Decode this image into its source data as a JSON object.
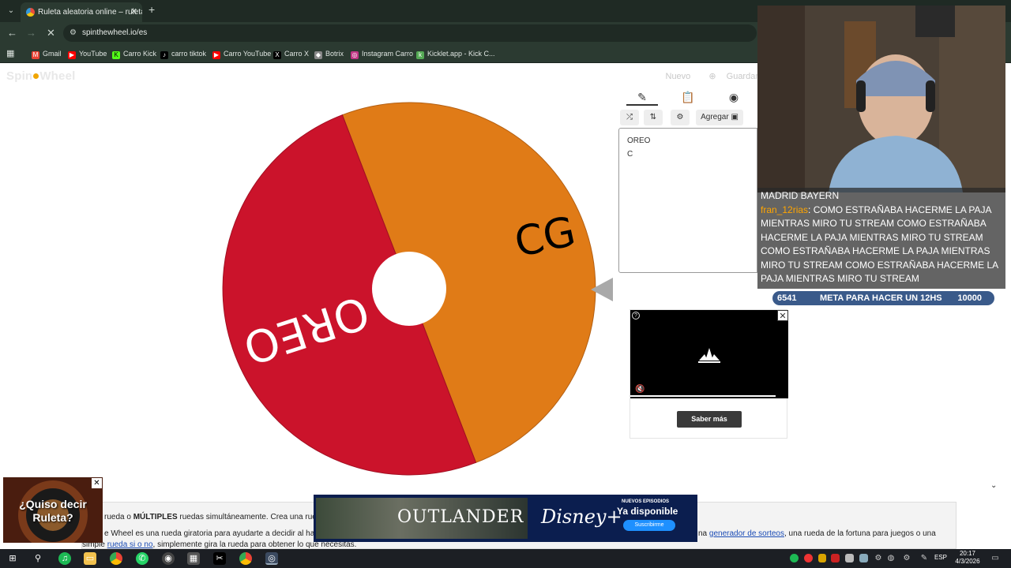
{
  "browser": {
    "tab_title": "Ruleta aleatoria online – ruleta",
    "url": "spinthewheel.io/es",
    "bookmarks": [
      "Gmail",
      "YouTube",
      "Carro Kick",
      "carro tiktok",
      "Carro YouTube",
      "Carro X",
      "Botrix",
      "Instagram Carro",
      "Kicklet.app - Kick C..."
    ]
  },
  "site": {
    "logo_left": "Spin",
    "logo_right": "Wheel",
    "nav_new": "Nuevo",
    "nav_save": "Guardar"
  },
  "wheel": {
    "segments": [
      {
        "label": "CG",
        "color": "#e07b17"
      },
      {
        "label": "OREO",
        "color": "#cb132b"
      }
    ]
  },
  "editor": {
    "add_label": "Agregar",
    "entries": [
      "OREO",
      "C"
    ]
  },
  "video_ad": {
    "cta": "Saber más"
  },
  "stream": {
    "chat_lines": [
      {
        "user": "",
        "text": "MADRID BAYERN"
      },
      {
        "user": "fran_12rias",
        "text": ": COMO ESTRAÑABA HACERME LA PAJA MIENTRAS MIRO TU STREAM COMO ESTRAÑABA HACERME LA PAJA MIENTRAS MIRO TU STREAM COMO ESTRAÑABA HACERME LA PAJA MIENTRAS MIRO TU STREAM COMO ESTRAÑABA HACERME LA PAJA MIENTRAS MIRO TU STREAM"
      }
    ],
    "goal_current": "6541",
    "goal_text": "META PARA HACER UN 12HS",
    "goal_target": "10000"
  },
  "bottom": {
    "line1_prefix": "rueda o ",
    "line1_bold": "MÚLTIPLES",
    "line1_rest": " ruedas simultáneamente. Crea una rueda pe",
    "line2_prefix": "e Wheel es una rueda giratoria para ayudarte a decidir al hacer u",
    "line2_mid": "na ",
    "line2_link": "generador de sorteos",
    "line2_rest": ", una rueda de la fortuna para juegos o una",
    "line3_prefix": "simple ",
    "line3_link": "rueda si o no",
    "line3_rest": ", simplemente gira la rueda para obtener lo que necesitas."
  },
  "ads": {
    "left_ad_text": "¿Quiso decir Ruleta?",
    "banner_title": "OUTLANDER",
    "banner_brand": "Disney+",
    "banner_new": "NUEVOS EPISODIOS",
    "banner_available": "Ya disponible",
    "banner_cta": "Suscribirme"
  },
  "taskbar": {
    "lang": "ESP",
    "time": "20:17",
    "date": "4/3/2026"
  }
}
